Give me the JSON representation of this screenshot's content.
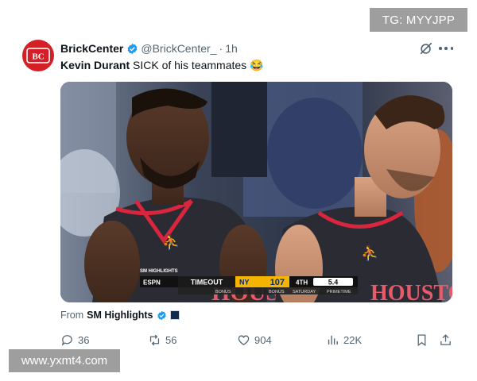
{
  "watermarks": {
    "top_right": "TG: MYYJPP",
    "bottom_left": "www.yxmt4.com"
  },
  "account": {
    "name": "BrickCenter",
    "handle": "@BrickCenter_",
    "separator": "·",
    "time": "1h",
    "avatar_text": "BC",
    "brand_color": "#d41f26"
  },
  "tweet": {
    "subject": "Kevin Durant",
    "text": " SICK of his teammates 😂"
  },
  "media": {
    "scorebug": {
      "network": "ESPN",
      "status": "TIMEOUT",
      "team": "NY",
      "score": "107",
      "quarter": "4TH",
      "clock": "5.4",
      "bonus_left": "BONUS",
      "bonus_right": "BONUS",
      "promo": "SATURDAY",
      "promo2": "PRIMETIME",
      "tag": "SM HIGHLIGHTS"
    },
    "jersey_text": "HOUSTON",
    "jersey_text_short": "HOUSTON"
  },
  "source": {
    "label": "From",
    "name": "SM Highlights"
  },
  "actions": {
    "replies": "36",
    "reposts": "56",
    "likes": "904",
    "views": "22K"
  },
  "colors": {
    "verified": "#1d9bf0",
    "text_secondary": "#536471",
    "jersey": "#2b2b33",
    "jersey_trim": "#d7263d"
  }
}
